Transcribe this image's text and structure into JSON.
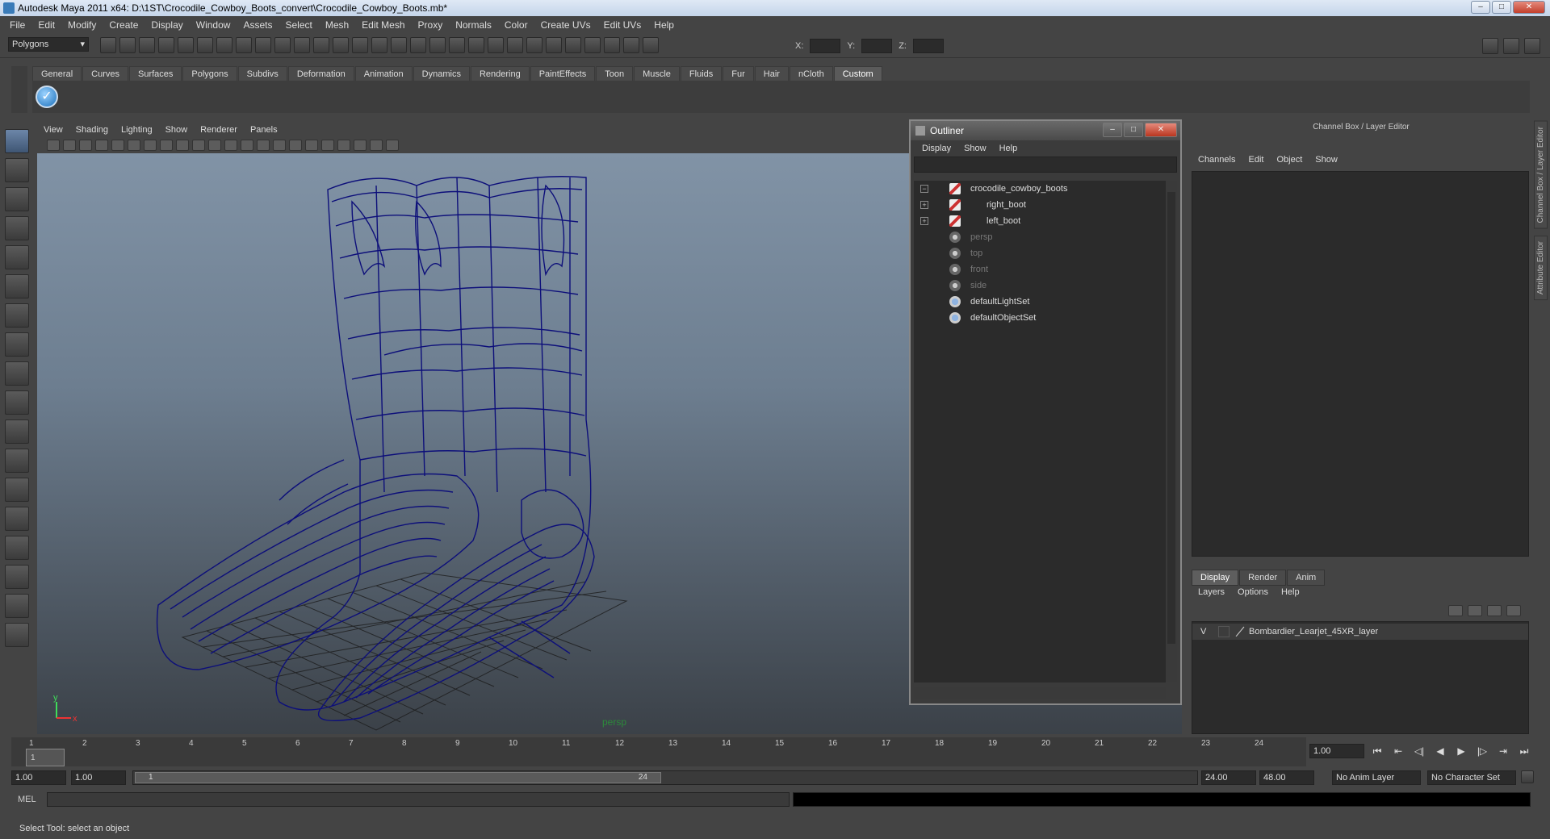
{
  "title": "Autodesk Maya 2011 x64: D:\\1ST\\Crocodile_Cowboy_Boots_convert\\Crocodile_Cowboy_Boots.mb*",
  "menus": [
    "File",
    "Edit",
    "Modify",
    "Create",
    "Display",
    "Window",
    "Assets",
    "Select",
    "Mesh",
    "Edit Mesh",
    "Proxy",
    "Normals",
    "Color",
    "Create UVs",
    "Edit UVs",
    "Help"
  ],
  "mode": "Polygons",
  "coords": {
    "x": "X:",
    "y": "Y:",
    "z": "Z:"
  },
  "shelf_tabs": [
    "General",
    "Curves",
    "Surfaces",
    "Polygons",
    "Subdivs",
    "Deformation",
    "Animation",
    "Dynamics",
    "Rendering",
    "PaintEffects",
    "Toon",
    "Muscle",
    "Fluids",
    "Fur",
    "Hair",
    "nCloth",
    "Custom"
  ],
  "active_shelf": "Custom",
  "viewport": {
    "menus": [
      "View",
      "Shading",
      "Lighting",
      "Show",
      "Renderer",
      "Panels"
    ],
    "camera_label": "persp",
    "axis": {
      "y": "y",
      "x": "x"
    }
  },
  "outliner": {
    "title": "Outliner",
    "menus": [
      "Display",
      "Show",
      "Help"
    ],
    "items": [
      {
        "name": "crocodile_cowboy_boots",
        "type": "mesh",
        "expander": "−",
        "indent": 0,
        "dim": false
      },
      {
        "name": "right_boot",
        "type": "mesh",
        "expander": "+",
        "indent": 1,
        "dim": false
      },
      {
        "name": "left_boot",
        "type": "mesh",
        "expander": "+",
        "indent": 1,
        "dim": false
      },
      {
        "name": "persp",
        "type": "cam",
        "expander": "",
        "indent": 0,
        "dim": true
      },
      {
        "name": "top",
        "type": "cam",
        "expander": "",
        "indent": 0,
        "dim": true
      },
      {
        "name": "front",
        "type": "cam",
        "expander": "",
        "indent": 0,
        "dim": true
      },
      {
        "name": "side",
        "type": "cam",
        "expander": "",
        "indent": 0,
        "dim": true
      },
      {
        "name": "defaultLightSet",
        "type": "set",
        "expander": "",
        "indent": 0,
        "dim": false
      },
      {
        "name": "defaultObjectSet",
        "type": "set",
        "expander": "",
        "indent": 0,
        "dim": false
      }
    ]
  },
  "channel_box": {
    "title": "Channel Box / Layer Editor",
    "menus": [
      "Channels",
      "Edit",
      "Object",
      "Show"
    ],
    "side_tabs": [
      "Channel Box / Layer Editor",
      "Attribute Editor"
    ]
  },
  "layer_editor": {
    "tabs": [
      "Display",
      "Render",
      "Anim"
    ],
    "active_tab": "Display",
    "menus": [
      "Layers",
      "Options",
      "Help"
    ],
    "layers": [
      {
        "visible": "V",
        "name": "Bombardier_Learjet_45XR_layer"
      }
    ]
  },
  "timeline": {
    "ticks": [
      "1",
      "2",
      "3",
      "4",
      "5",
      "6",
      "7",
      "8",
      "9",
      "10",
      "11",
      "12",
      "13",
      "14",
      "15",
      "16",
      "17",
      "18",
      "19",
      "20",
      "21",
      "22",
      "23",
      "24"
    ],
    "current_frame": "1",
    "current_value": "1.00"
  },
  "range": {
    "start": "1.00",
    "playback_start": "1.00",
    "slider_start": "1",
    "slider_end": "24",
    "playback_end": "24.00",
    "end": "48.00",
    "anim_layer": "No Anim Layer",
    "char_set": "No Character Set"
  },
  "command_line": {
    "label": "MEL"
  },
  "help_line": "Select Tool: select an object",
  "colors": {
    "wireframe": "#0d0f7a",
    "background_top": "#8193a6",
    "background_bottom": "#3b4148"
  }
}
